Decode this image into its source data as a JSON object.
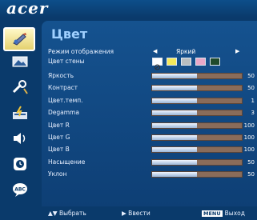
{
  "brand": {
    "logo": "acer"
  },
  "sidebar": {
    "items": [
      {
        "icon": "color-palette-icon",
        "active": true
      },
      {
        "icon": "image-icon",
        "active": false
      },
      {
        "icon": "settings-icon",
        "active": false
      },
      {
        "icon": "management-icon",
        "active": false
      },
      {
        "icon": "speaker-icon",
        "active": false
      },
      {
        "icon": "timer-icon",
        "active": false
      },
      {
        "icon": "language-icon",
        "active": false
      }
    ]
  },
  "panel": {
    "title": "Цвет",
    "display_mode": {
      "label": "Режим отображения",
      "value": "Яркий"
    },
    "wall_color": {
      "label": "Цвет стены",
      "swatches": [
        "#ffffff",
        "#f4e85a",
        "#b9bec0",
        "#e8a8c8",
        "#1f4a2c"
      ]
    },
    "sliders": [
      {
        "label": "Яркость",
        "value": "50",
        "level": 0.5
      },
      {
        "label": "Контраст",
        "value": "50",
        "level": 0.5
      },
      {
        "label": "Цвет.темп.",
        "value": "1",
        "level": 0.5
      },
      {
        "label": "Degamma",
        "value": "3",
        "level": 0.5
      },
      {
        "label": "Цвет R",
        "value": "100",
        "level": 0.5
      },
      {
        "label": "Цвет G",
        "value": "100",
        "level": 0.5
      },
      {
        "label": "Цвет B",
        "value": "100",
        "level": 0.5
      },
      {
        "label": "Насыщение",
        "value": "50",
        "level": 0.5
      },
      {
        "label": "Уклон",
        "value": "50",
        "level": 0.5
      }
    ]
  },
  "footer": {
    "select": "Выбрать",
    "enter": "Ввести",
    "menu_key": "MENU",
    "exit": "Выход"
  }
}
